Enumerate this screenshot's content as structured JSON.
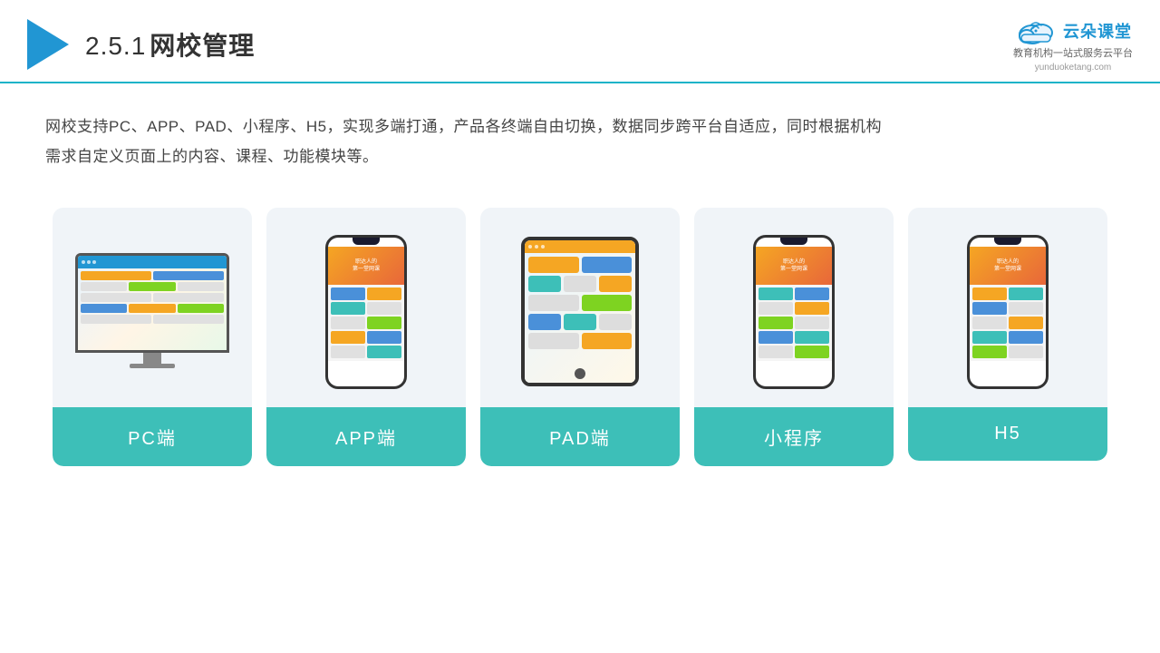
{
  "header": {
    "section_num": "2.5.1",
    "title": "网校管理",
    "brand_name": "云朵课堂",
    "brand_tagline": "教育机构一站\n式服务云平台",
    "brand_url": "yunduoketang.com"
  },
  "description": {
    "text": "网校支持PC、APP、PAD、小程序、H5，实现多端打通，产品各终端自由切换，数据同步跨平台自适应，同时根据机构需求自定义页面上的内容、课程、功能模块等。"
  },
  "cards": [
    {
      "id": "pc",
      "label": "PC端",
      "device": "pc"
    },
    {
      "id": "app",
      "label": "APP端",
      "device": "phone"
    },
    {
      "id": "pad",
      "label": "PAD端",
      "device": "pad"
    },
    {
      "id": "miniprogram",
      "label": "小程序",
      "device": "phone2"
    },
    {
      "id": "h5",
      "label": "H5",
      "device": "phone3"
    }
  ],
  "colors": {
    "accent": "#3dbfb8",
    "header_line": "#1ab3c8",
    "brand_blue": "#2196d3",
    "card_bg": "#f0f4f8"
  }
}
